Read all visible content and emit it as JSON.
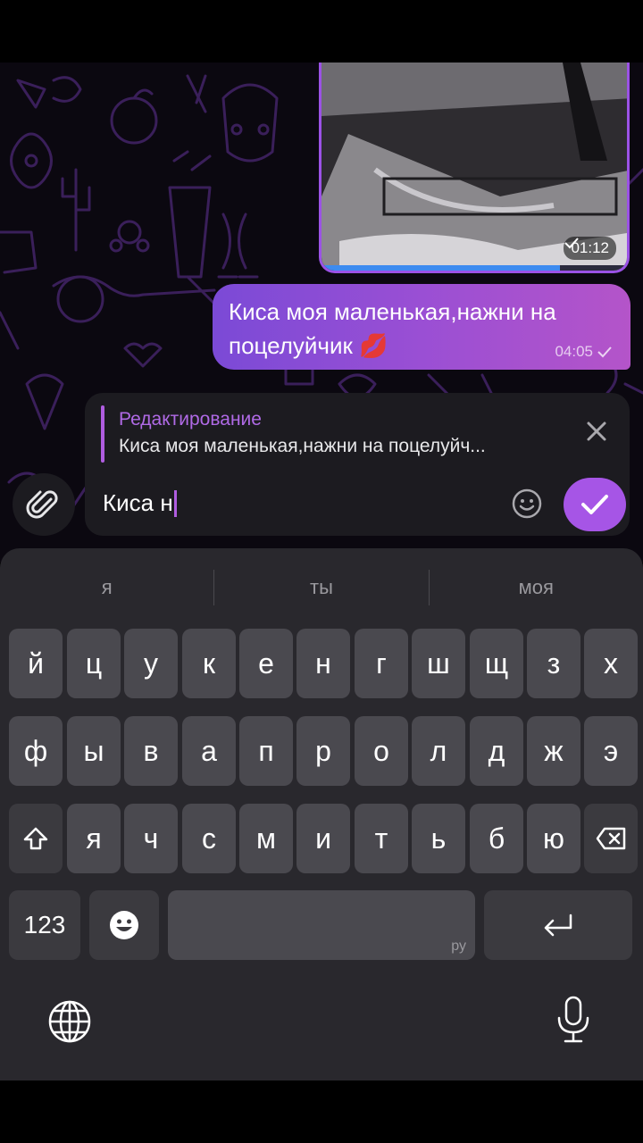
{
  "chat": {
    "video_message": {
      "time": "01:12",
      "check_icon": "check-icon",
      "progress": 0.78
    },
    "text_message": {
      "text": "Киса моя маленькая,нажни на поцелуйчик 💋",
      "time": "04:05",
      "check_icon": "check-icon"
    }
  },
  "composer": {
    "edit_title": "Редактирование",
    "edit_preview": "Киса моя маленькая,нажни на поцелуйч...",
    "input_value": "Киса н",
    "close_icon": "close-icon",
    "emoji_icon": "smiley-icon",
    "attach_icon": "paperclip-icon",
    "send_icon": "checkmark-icon"
  },
  "keyboard": {
    "suggestions": [
      "я",
      "ты",
      "моя"
    ],
    "row1": [
      "й",
      "ц",
      "у",
      "к",
      "е",
      "н",
      "г",
      "ш",
      "щ",
      "з",
      "х"
    ],
    "row2": [
      "ф",
      "ы",
      "в",
      "а",
      "п",
      "р",
      "о",
      "л",
      "д",
      "ж",
      "э"
    ],
    "row3": [
      "я",
      "ч",
      "с",
      "м",
      "и",
      "т",
      "ь",
      "б",
      "ю"
    ],
    "numbers_label": "123",
    "space_lang": "ру",
    "icons": {
      "shift": "shift-icon",
      "backspace": "backspace-icon",
      "emoji": "emoji-icon",
      "return": "return-icon",
      "globe": "globe-icon",
      "mic": "microphone-icon"
    }
  },
  "colors": {
    "accent": "#a655e6",
    "bubble_start": "#7b4ad6",
    "bubble_end": "#b454c9",
    "keyboard_bg": "#29282d",
    "key_bg": "#4a494f"
  }
}
